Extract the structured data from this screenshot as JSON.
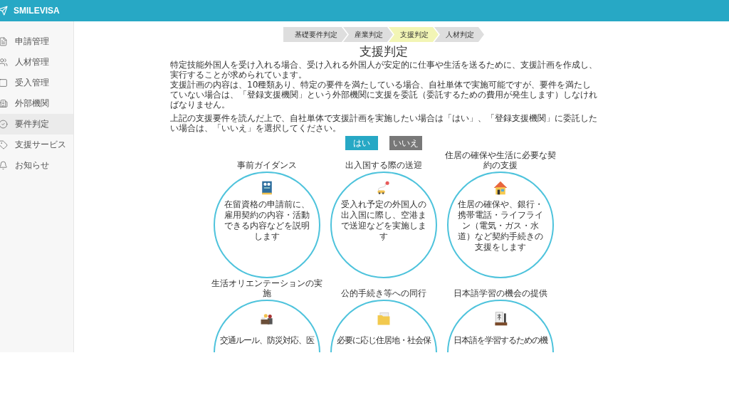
{
  "header": {
    "brand": "SMILEVISA"
  },
  "sidebar": {
    "items": [
      {
        "label": "申請管理",
        "selected": false
      },
      {
        "label": "人材管理",
        "selected": false
      },
      {
        "label": "受入管理",
        "selected": false
      },
      {
        "label": "外部機関",
        "selected": false
      },
      {
        "label": "要件判定",
        "selected": true
      },
      {
        "label": "支援サービス",
        "selected": false
      },
      {
        "label": "お知らせ",
        "selected": false
      }
    ]
  },
  "steps": [
    {
      "label": "基礎要件判定",
      "selected": false
    },
    {
      "label": "産業判定",
      "selected": false
    },
    {
      "label": "支援判定",
      "selected": true
    },
    {
      "label": "人材判定",
      "selected": false
    }
  ],
  "title": "支援判定",
  "paragraphs": [
    "特定技能外国人を受け入れる場合、受け入れる外国人が安定的に仕事や生活を送るために、支援計画を作成し、実行することが求められています。",
    "支援計画の内容は、10種類あり、特定の要件を満たしている場合、自社単体で実施可能ですが、要件を満たしていない場合は、「登録支援機関」という外部機関に支援を委託（委託するための費用が発生します）しなければなりません。",
    "上記の支援要件を読んだ上で、自社単体で支援計画を実施したい場合は「はい」、「登録支援機関」に委託したい場合は、「いいえ」を選択してください。"
  ],
  "buttons": [
    {
      "label": "はい",
      "kind": "primary"
    },
    {
      "label": "いいえ",
      "kind": "secondary"
    }
  ],
  "services": [
    {
      "title": "事前ガイダンス",
      "description": "在留資格の申請前に、雇用契約の内容・活動できる内容などを説明します"
    },
    {
      "title": "出入国する際の送迎",
      "description": "受入れ予定の外国人の出入国に際し、空港まで送迎などを実施します"
    },
    {
      "title": "住居の確保や生活に必要な契約の支援",
      "description": "住居の確保や、銀行・携帯電話・ライフライン（電気・ガス・水道）など契約手続きの支援をします"
    },
    {
      "title": "生活オリエンテーションの実施",
      "description": "交通ルール、防災対応、医"
    },
    {
      "title": "公的手続き等への同行",
      "description": "必要に応じ住居地・社会保"
    },
    {
      "title": "日本語学習の機会の提供",
      "description": "日本語を学習するための機"
    }
  ]
}
